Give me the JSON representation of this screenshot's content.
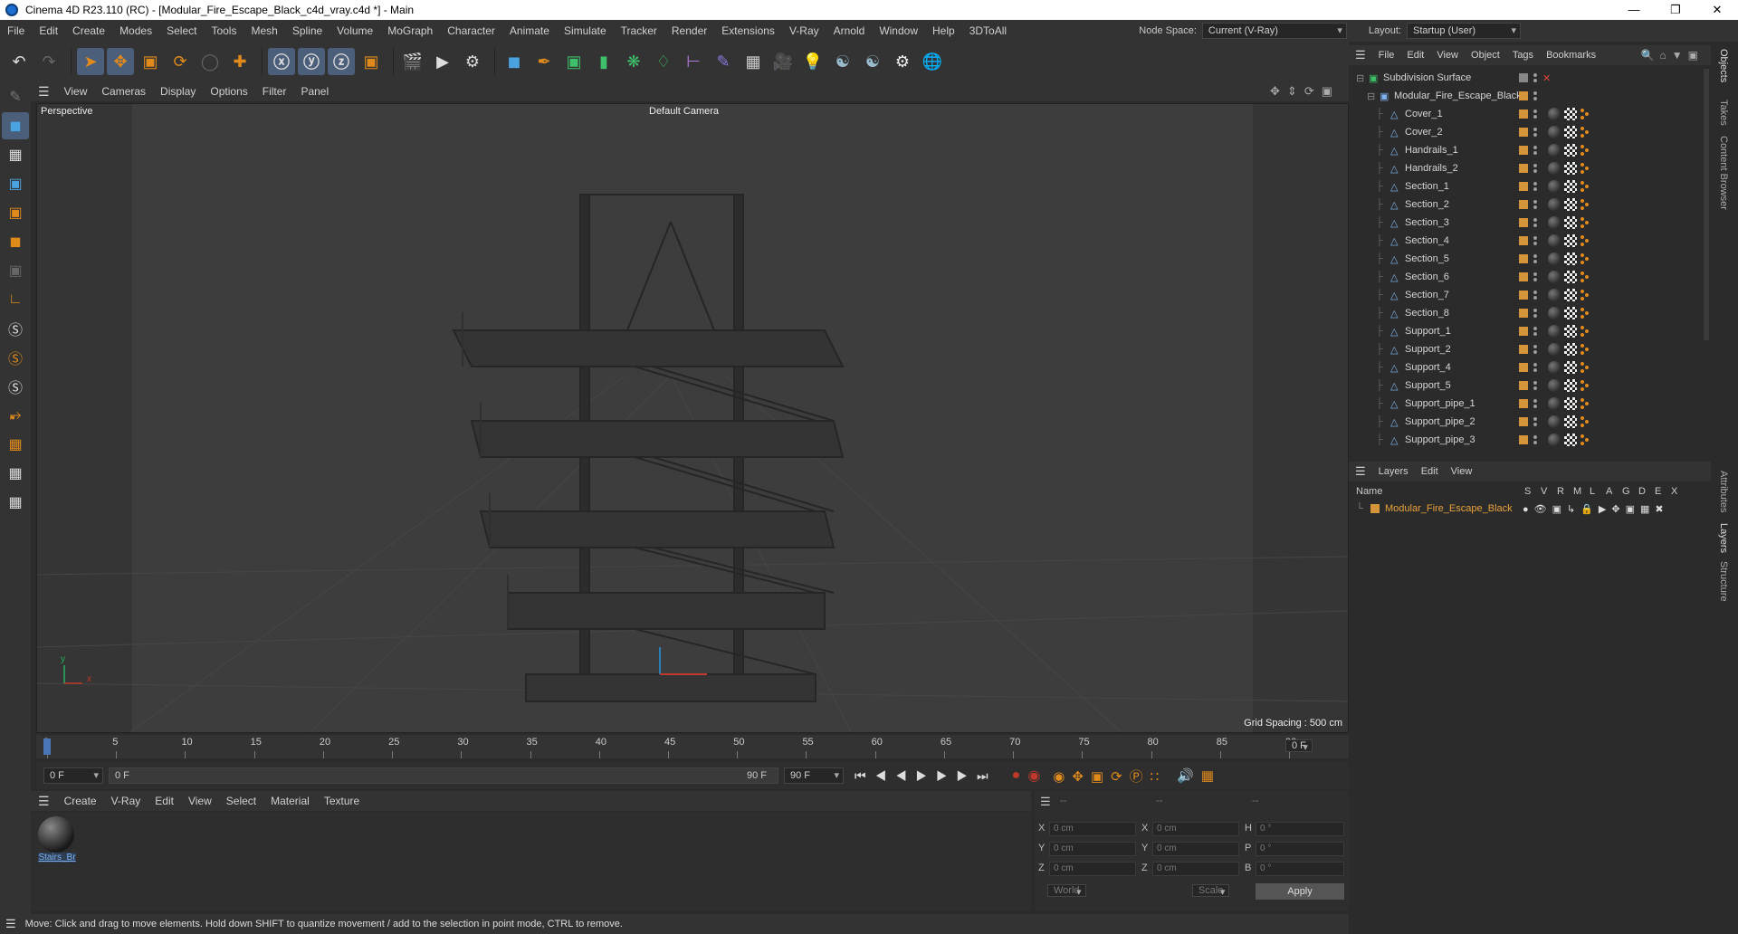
{
  "window": {
    "title": "Cinema 4D R23.110 (RC) - [Modular_Fire_Escape_Black_c4d_vray.c4d *] - Main",
    "controls": [
      "—",
      "❐",
      "✕"
    ]
  },
  "menubar": {
    "items": [
      "File",
      "Edit",
      "Create",
      "Modes",
      "Select",
      "Tools",
      "Mesh",
      "Spline",
      "Volume",
      "MoGraph",
      "Character",
      "Animate",
      "Simulate",
      "Tracker",
      "Render",
      "Extensions",
      "V-Ray",
      "Arnold",
      "Window",
      "Help",
      "3DToAll"
    ],
    "node_space_label": "Node Space:",
    "node_space_value": "Current (V-Ray)",
    "layout_label": "Layout:",
    "layout_value": "Startup (User)"
  },
  "viewport": {
    "menu": [
      "View",
      "Cameras",
      "Display",
      "Options",
      "Filter",
      "Panel"
    ],
    "view_name": "Perspective",
    "camera": "Default Camera",
    "grid_spacing": "Grid Spacing : 500 cm",
    "axis_x": "x",
    "axis_y": "y"
  },
  "timeline": {
    "ticks": [
      "0",
      "5",
      "10",
      "15",
      "20",
      "25",
      "30",
      "35",
      "40",
      "45",
      "50",
      "55",
      "60",
      "65",
      "70",
      "75",
      "80",
      "85",
      "90"
    ],
    "frame_right": "0 F",
    "start_frame": "0 F",
    "current_frame": "0 F",
    "end_frame_display": "90 F",
    "end_frame": "90 F"
  },
  "materials": {
    "menu": [
      "Create",
      "V-Ray",
      "Edit",
      "View",
      "Select",
      "Material",
      "Texture"
    ],
    "items": [
      {
        "name": "Stairs_Br"
      }
    ]
  },
  "coordinates": {
    "header": [
      "--",
      "--",
      "--"
    ],
    "rows": [
      {
        "l1": "X",
        "v1": "0 cm",
        "l2": "X",
        "v2": "0 cm",
        "l3": "H",
        "v3": "0 °"
      },
      {
        "l1": "Y",
        "v1": "0 cm",
        "l2": "Y",
        "v2": "0 cm",
        "l3": "P",
        "v3": "0 °"
      },
      {
        "l1": "Z",
        "v1": "0 cm",
        "l2": "Z",
        "v2": "0 cm",
        "l3": "B",
        "v3": "0 °"
      }
    ],
    "space": "World",
    "mode": "Scale",
    "apply": "Apply"
  },
  "status": "Move: Click and drag to move elements. Hold down SHIFT to quantize movement / add to the selection in point mode, CTRL to remove.",
  "objects": {
    "menu": [
      "File",
      "Edit",
      "View",
      "Object",
      "Tags",
      "Bookmarks"
    ],
    "root": "Subdivision Surface",
    "group": "Modular_Fire_Escape_Black",
    "children": [
      "Cover_1",
      "Cover_2",
      "Handrails_1",
      "Handrails_2",
      "Section_1",
      "Section_2",
      "Section_3",
      "Section_4",
      "Section_5",
      "Section_6",
      "Section_7",
      "Section_8",
      "Support_1",
      "Support_2",
      "Support_4",
      "Support_5",
      "Support_pipe_1",
      "Support_pipe_2",
      "Support_pipe_3"
    ]
  },
  "layers": {
    "menu": [
      "Layers",
      "Edit",
      "View"
    ],
    "columns": [
      "Name",
      "S",
      "V",
      "R",
      "M",
      "L",
      "A",
      "G",
      "D",
      "E",
      "X"
    ],
    "items": [
      {
        "name": "Modular_Fire_Escape_Black",
        "color": "#d4943a"
      }
    ]
  },
  "side_tabs": [
    "Objects",
    "Takes",
    "Content Browser",
    "Attributes",
    "Layers",
    "Structure"
  ],
  "colors": {
    "accent_orange": "#e08a1c",
    "layer_text": "#e8a23a",
    "axis_x": "#c0392b",
    "axis_y": "#27ae60",
    "axis_z": "#2980b9"
  }
}
